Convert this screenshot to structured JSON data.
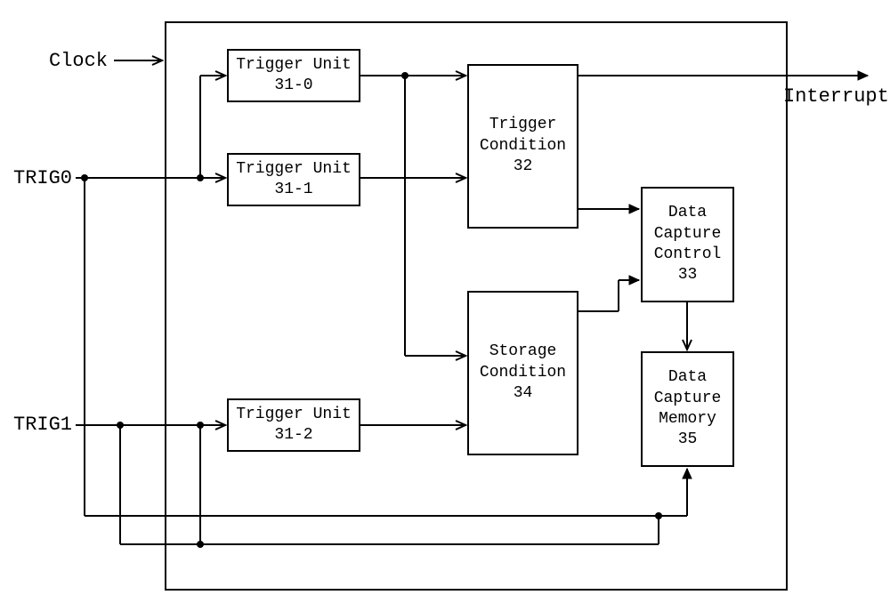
{
  "inputs": {
    "clock": "Clock",
    "trig0": "TRIG0",
    "trig1": "TRIG1"
  },
  "outputs": {
    "interrupt": "Interrupt"
  },
  "blocks": {
    "tu0": {
      "name": "Trigger Unit",
      "id": "31-0"
    },
    "tu1": {
      "name": "Trigger Unit",
      "id": "31-1"
    },
    "tu2": {
      "name": "Trigger Unit",
      "id": "31-2"
    },
    "tc": {
      "name": "Trigger",
      "name2": "Condition",
      "id": "32"
    },
    "sc": {
      "name": "Storage",
      "name2": "Condition",
      "id": "34"
    },
    "dcc": {
      "name": "Data",
      "name2": "Capture",
      "name3": "Control",
      "id": "33"
    },
    "dcm": {
      "name": "Data",
      "name2": "Capture",
      "name3": "Memory",
      "id": "35"
    }
  }
}
